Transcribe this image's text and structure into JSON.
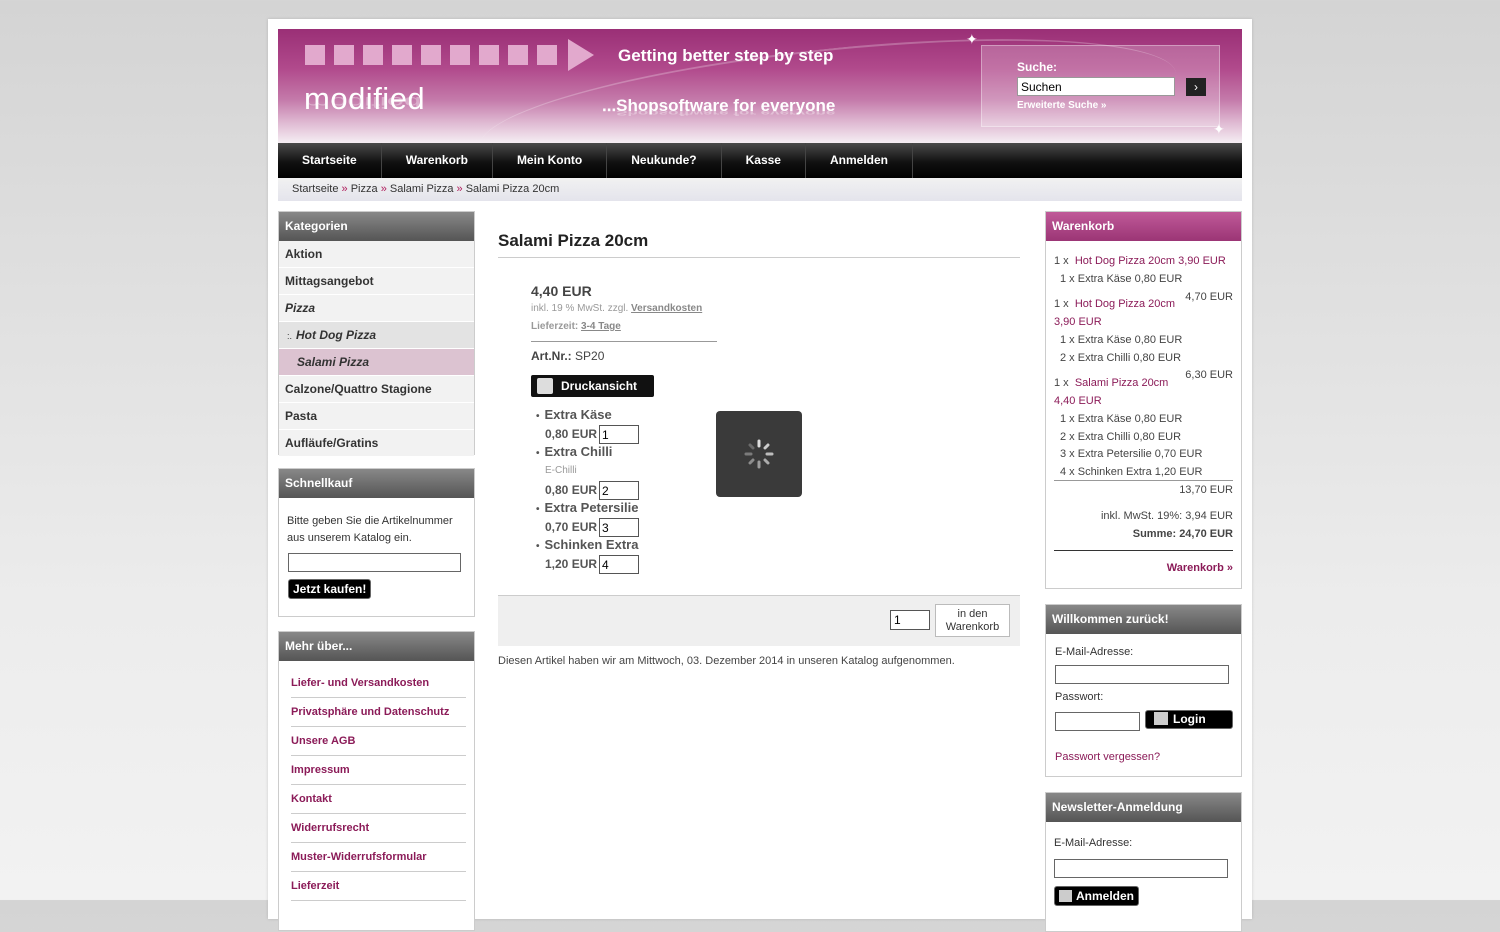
{
  "header": {
    "tagline1": "Getting better step by step",
    "logo": "modified",
    "tagline2": "...Shopsoftware for everyone",
    "search_label": "Suche:",
    "search_value": "Suchen",
    "search_adv": "Erweiterte Suche »",
    "search_go": "›"
  },
  "nav": [
    "Startseite",
    "Warenkorb",
    "Mein Konto",
    "Neukunde?",
    "Kasse",
    "Anmelden"
  ],
  "breadcrumb": [
    "Startseite",
    "Pizza",
    "Salami Pizza",
    "Salami Pizza 20cm"
  ],
  "breadcrumb_sep": "»",
  "categories": {
    "title": "Kategorien",
    "items": [
      "Aktion",
      "Mittagsangebot",
      "Pizza",
      "Hot Dog Pizza",
      "Salami Pizza",
      "Calzone/Quattro Stagione",
      "Pasta",
      "Aufläufe/Gratins"
    ],
    "hot_dog_prefix": ":."
  },
  "schnellkauf": {
    "title": "Schnellkauf",
    "text": "Bitte geben Sie die Artikelnummer aus unserem Katalog ein.",
    "button": "Jetzt kaufen!"
  },
  "mehr": {
    "title": "Mehr über...",
    "items": [
      "Liefer- und Versandkosten",
      "Privatsphäre und Datenschutz",
      "Unsere AGB",
      "Impressum",
      "Kontakt",
      "Widerrufsrecht",
      "Muster-Widerrufsformular",
      "Lieferzeit"
    ]
  },
  "product": {
    "title": "Salami Pizza 20cm",
    "price": "4,40 EUR",
    "tax_text": "inkl. 19 % MwSt. zzgl.",
    "tax_link": "Versandkosten",
    "delivery_label": "Lieferzeit:",
    "delivery_value": "3-4 Tage",
    "artnr_label": "Art.Nr.:",
    "artnr_value": "SP20",
    "print_button": "Druckansicht",
    "options": [
      {
        "name": "Extra Käse",
        "price": "0,80 EUR",
        "qty": "1",
        "sub": ""
      },
      {
        "name": "Extra Chilli",
        "price": "0,80 EUR",
        "qty": "2",
        "sub": "E-Chilli"
      },
      {
        "name": "Extra Petersilie",
        "price": "0,70 EUR",
        "qty": "3",
        "sub": ""
      },
      {
        "name": "Schinken Extra",
        "price": "1,20 EUR",
        "qty": "4",
        "sub": ""
      }
    ],
    "qty": "1",
    "add_button_line1": "in den",
    "add_button_line2": "Warenkorb",
    "added_note": "Diesen Artikel haben wir am Mittwoch, 03. Dezember 2014 in unseren Katalog aufgenommen."
  },
  "cart": {
    "title": "Warenkorb",
    "lines": {
      "l1_qty": "1 x",
      "l1_name": "Hot Dog Pizza 20cm 3,90 EUR",
      "l1_opt1": "1 x Extra Käse 0,80 EUR",
      "l1_total": "4,70 EUR",
      "l2_qty": "1 x",
      "l2_name": "Hot Dog Pizza 20cm",
      "l2_price": "3,90 EUR",
      "l2_opt1": "1 x Extra Käse 0,80 EUR",
      "l2_opt2": "2 x Extra Chilli 0,80 EUR",
      "l2_total": "6,30 EUR",
      "l3_qty": "1 x",
      "l3_name": "Salami Pizza 20cm",
      "l3_price": "4,40 EUR",
      "l3_opt1": "1 x Extra Käse 0,80 EUR",
      "l3_opt2": "2 x Extra Chilli 0,80 EUR",
      "l3_opt3": "3 x Extra Petersilie 0,70 EUR",
      "l3_opt4": "4 x Schinken Extra 1,20 EUR",
      "l3_total": "13,70 EUR"
    },
    "tax": "inkl. MwSt. 19%: 3,94 EUR",
    "sum": "Summe: 24,70 EUR",
    "link": "Warenkorb »"
  },
  "login": {
    "title": "Willkommen zurück!",
    "email_label": "E-Mail-Adresse:",
    "password_label": "Passwort:",
    "button": "Login",
    "forgot": "Passwort vergessen?"
  },
  "newsletter": {
    "title": "Newsletter-Anmeldung",
    "email_label": "E-Mail-Adresse:",
    "button": "Anmelden"
  },
  "colors": {
    "accent": "#9b3575",
    "link": "#8b1b58",
    "nav": "#111111"
  }
}
